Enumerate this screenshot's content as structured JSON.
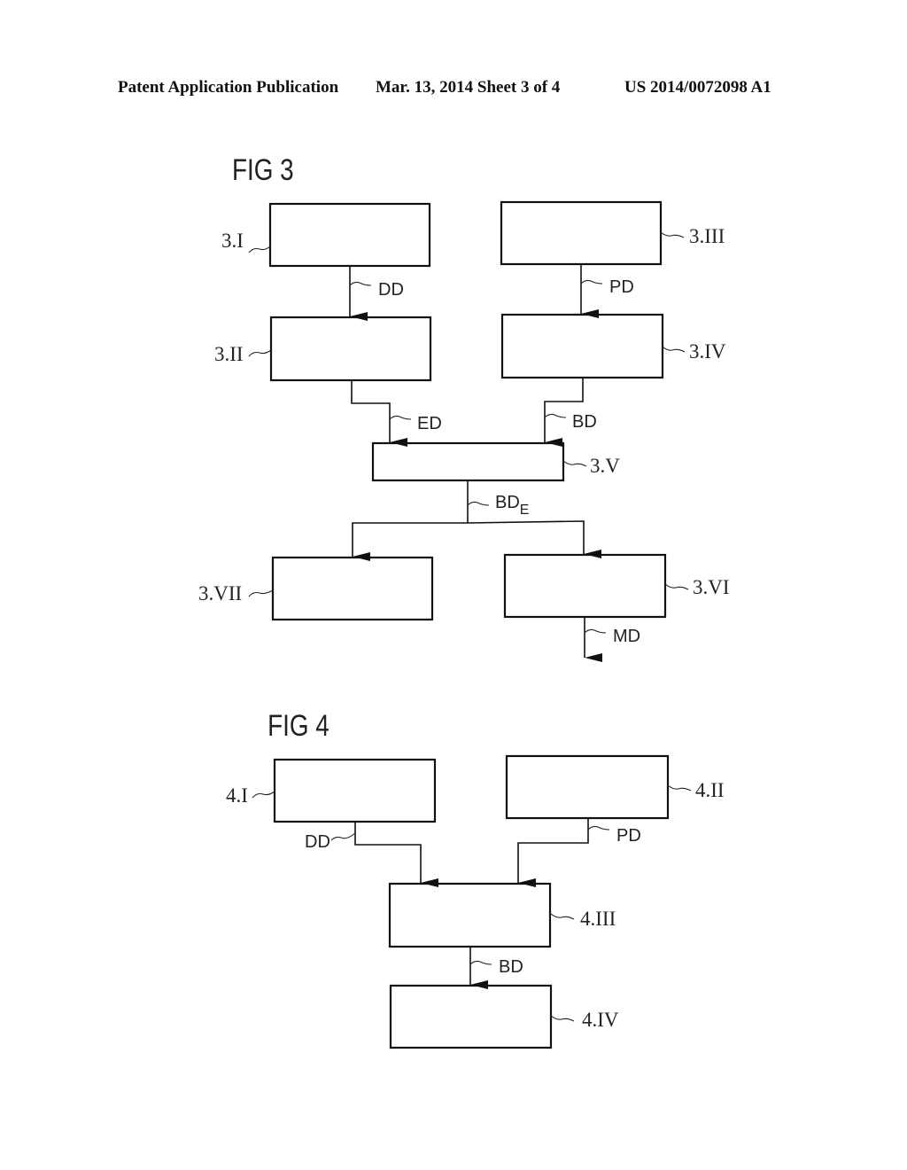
{
  "header": {
    "publication": "Patent Application Publication",
    "date_sheet": "Mar. 13, 2014  Sheet 3 of 4",
    "number": "US 2014/0072098 A1"
  },
  "fig3": {
    "title": "FIG 3",
    "blocks": [
      {
        "id": "3.I",
        "label": "3.I"
      },
      {
        "id": "3.II",
        "label": "3.II"
      },
      {
        "id": "3.III",
        "label": "3.III"
      },
      {
        "id": "3.IV",
        "label": "3.IV"
      },
      {
        "id": "3.V",
        "label": "3.V"
      },
      {
        "id": "3.VI",
        "label": "3.VI"
      },
      {
        "id": "3.VII",
        "label": "3.VII"
      }
    ],
    "signals": {
      "dd": "DD",
      "pd": "PD",
      "ed": "ED",
      "bd": "BD",
      "bde_main": "BD",
      "bde_sub": "E",
      "md": "MD"
    },
    "edges": [
      {
        "from": "3.I",
        "to": "3.II",
        "label": "DD"
      },
      {
        "from": "3.III",
        "to": "3.IV",
        "label": "PD"
      },
      {
        "from": "3.II",
        "to": "3.V",
        "label": "ED"
      },
      {
        "from": "3.IV",
        "to": "3.V",
        "label": "BD"
      },
      {
        "from": "3.V",
        "to": "3.VII",
        "label": "BDE"
      },
      {
        "from": "3.V",
        "to": "3.VI",
        "label": "BDE"
      },
      {
        "from": "3.VI",
        "to": "output",
        "label": "MD"
      }
    ]
  },
  "fig4": {
    "title": "FIG 4",
    "blocks": [
      {
        "id": "4.I",
        "label": "4.I"
      },
      {
        "id": "4.II",
        "label": "4.II"
      },
      {
        "id": "4.III",
        "label": "4.III"
      },
      {
        "id": "4.IV",
        "label": "4.IV"
      }
    ],
    "signals": {
      "dd": "DD",
      "pd": "PD",
      "bd": "BD"
    },
    "edges": [
      {
        "from": "4.I",
        "to": "4.III",
        "label": "DD"
      },
      {
        "from": "4.II",
        "to": "4.III",
        "label": "PD"
      },
      {
        "from": "4.III",
        "to": "4.IV",
        "label": "BD"
      }
    ]
  }
}
